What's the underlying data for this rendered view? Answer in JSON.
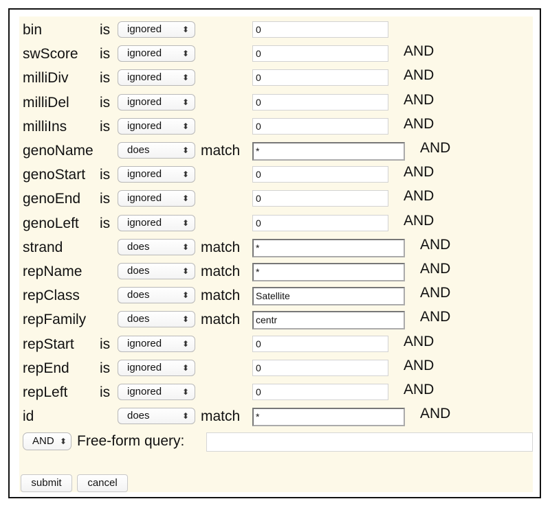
{
  "rows": [
    {
      "field": "bin",
      "op_word": "is",
      "select": "ignored",
      "match_word": "",
      "value": "0",
      "kind": "num",
      "conj": ""
    },
    {
      "field": "swScore",
      "op_word": "is",
      "select": "ignored",
      "match_word": "",
      "value": "0",
      "kind": "num",
      "conj": "AND"
    },
    {
      "field": "milliDiv",
      "op_word": "is",
      "select": "ignored",
      "match_word": "",
      "value": "0",
      "kind": "num",
      "conj": "AND"
    },
    {
      "field": "milliDel",
      "op_word": "is",
      "select": "ignored",
      "match_word": "",
      "value": "0",
      "kind": "num",
      "conj": "AND"
    },
    {
      "field": "milliIns",
      "op_word": "is",
      "select": "ignored",
      "match_word": "",
      "value": "0",
      "kind": "num",
      "conj": "AND"
    },
    {
      "field": "genoName",
      "op_word": "",
      "select": "does",
      "match_word": "match",
      "value": "*",
      "kind": "match",
      "conj": "AND"
    },
    {
      "field": "genoStart",
      "op_word": "is",
      "select": "ignored",
      "match_word": "",
      "value": "0",
      "kind": "num",
      "conj": "AND"
    },
    {
      "field": "genoEnd",
      "op_word": "is",
      "select": "ignored",
      "match_word": "",
      "value": "0",
      "kind": "num",
      "conj": "AND"
    },
    {
      "field": "genoLeft",
      "op_word": "is",
      "select": "ignored",
      "match_word": "",
      "value": "0",
      "kind": "num",
      "conj": "AND"
    },
    {
      "field": "strand",
      "op_word": "",
      "select": "does",
      "match_word": "match",
      "value": "*",
      "kind": "match",
      "conj": "AND"
    },
    {
      "field": "repName",
      "op_word": "",
      "select": "does",
      "match_word": "match",
      "value": "*",
      "kind": "match",
      "conj": "AND"
    },
    {
      "field": "repClass",
      "op_word": "",
      "select": "does",
      "match_word": "match",
      "value": "Satellite",
      "kind": "match",
      "conj": "AND"
    },
    {
      "field": "repFamily",
      "op_word": "",
      "select": "does",
      "match_word": "match",
      "value": "centr",
      "kind": "match",
      "conj": "AND"
    },
    {
      "field": "repStart",
      "op_word": "is",
      "select": "ignored",
      "match_word": "",
      "value": "0",
      "kind": "num",
      "conj": "AND"
    },
    {
      "field": "repEnd",
      "op_word": "is",
      "select": "ignored",
      "match_word": "",
      "value": "0",
      "kind": "num",
      "conj": "AND"
    },
    {
      "field": "repLeft",
      "op_word": "is",
      "select": "ignored",
      "match_word": "",
      "value": "0",
      "kind": "num",
      "conj": "AND"
    },
    {
      "field": "id",
      "op_word": "",
      "select": "does",
      "match_word": "match",
      "value": "*",
      "kind": "match",
      "conj": "AND"
    }
  ],
  "select_arrows": "⬍",
  "freeform": {
    "conj_select": "AND",
    "label": "Free-form query:",
    "value": ""
  },
  "buttons": {
    "submit": "submit",
    "cancel": "cancel"
  }
}
